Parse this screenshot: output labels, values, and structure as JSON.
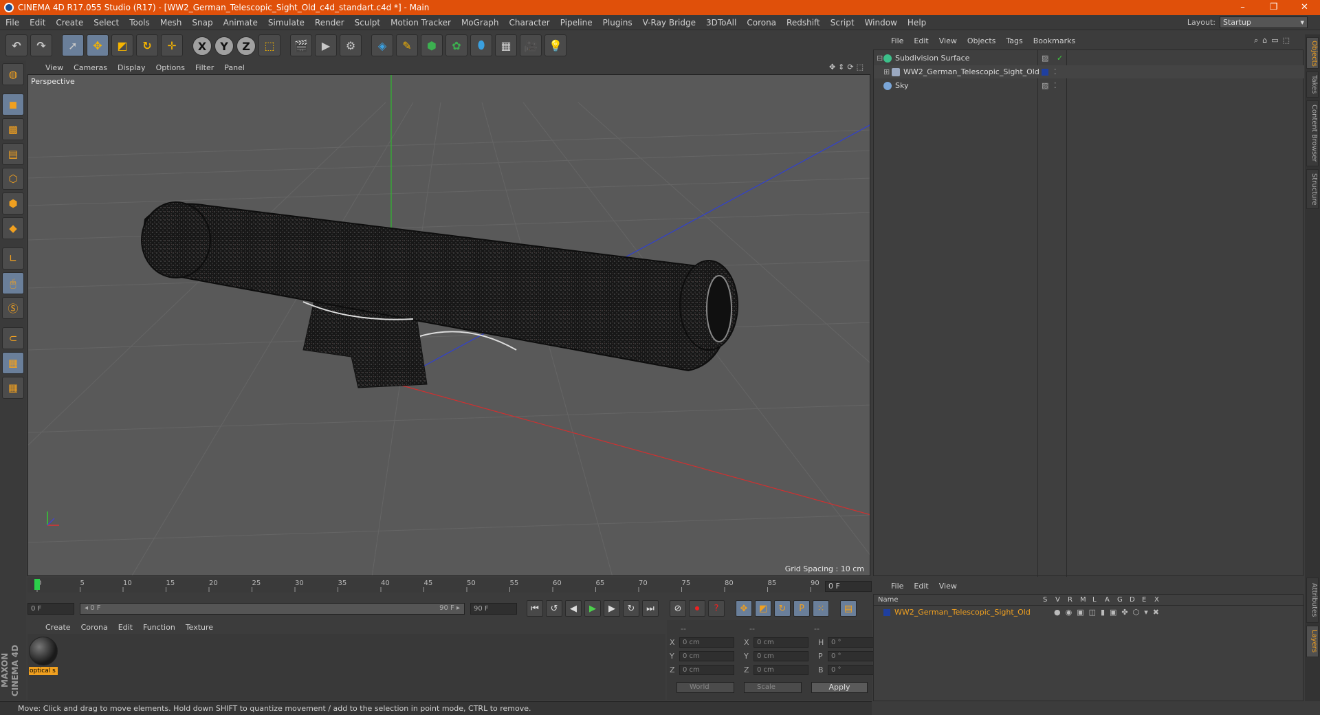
{
  "window": {
    "title": "CINEMA 4D R17.055 Studio (R17) - [WW2_German_Telescopic_Sight_Old_c4d_standart.c4d *] - Main",
    "controls": [
      "–",
      "❐",
      "✕"
    ]
  },
  "menu": [
    "File",
    "Edit",
    "Create",
    "Select",
    "Tools",
    "Mesh",
    "Snap",
    "Animate",
    "Simulate",
    "Render",
    "Sculpt",
    "Motion Tracker",
    "MoGraph",
    "Character",
    "Pipeline",
    "Plugins",
    "V-Ray Bridge",
    "3DToAll",
    "Corona",
    "Redshift",
    "Script",
    "Window",
    "Help"
  ],
  "layout": {
    "label": "Layout:",
    "value": "Startup"
  },
  "viewport": {
    "menu": [
      "View",
      "Cameras",
      "Display",
      "Options",
      "Filter",
      "Panel"
    ],
    "label": "Perspective",
    "grid_spacing": "Grid Spacing : 10 cm"
  },
  "timeline": {
    "ticks": [
      "0",
      "5",
      "10",
      "15",
      "20",
      "25",
      "30",
      "35",
      "40",
      "45",
      "50",
      "55",
      "60",
      "65",
      "70",
      "75",
      "80",
      "85",
      "90"
    ],
    "current_frame": "0 F",
    "start": "0 F",
    "range_start": "◂ 0 F",
    "range_end": "90 F ▸",
    "end": "90 F"
  },
  "materials": {
    "menu": [
      "Create",
      "Corona",
      "Edit",
      "Function",
      "Texture"
    ],
    "items": [
      {
        "name": "optical s"
      }
    ]
  },
  "coords": {
    "headers": [
      "--",
      "--",
      "--"
    ],
    "rows": [
      {
        "a": "X",
        "av": "0 cm",
        "b": "X",
        "bv": "0 cm",
        "c": "H",
        "cv": "0 °"
      },
      {
        "a": "Y",
        "av": "0 cm",
        "b": "Y",
        "bv": "0 cm",
        "c": "P",
        "cv": "0 °"
      },
      {
        "a": "Z",
        "av": "0 cm",
        "b": "Z",
        "bv": "0 cm",
        "c": "B",
        "cv": "0 °"
      }
    ],
    "mode1": "World",
    "mode2": "Scale",
    "apply": "Apply"
  },
  "status": "Move: Click and drag to move elements. Hold down SHIFT to quantize movement / add to the selection in point mode, CTRL to remove.",
  "maxon": {
    "line1": "MAXON",
    "line2": "CINEMA 4D"
  },
  "objects": {
    "menu": [
      "File",
      "Edit",
      "View",
      "Objects",
      "Tags",
      "Bookmarks"
    ],
    "items": [
      {
        "name": "Subdivision Surface",
        "color": "#3cc08a"
      },
      {
        "name": "WW2_German_Telescopic_Sight_Old",
        "color": "#9aa8c0"
      },
      {
        "name": "Sky",
        "color": "#7aa6d8"
      }
    ]
  },
  "layers": {
    "menu": [
      "File",
      "Edit",
      "View"
    ],
    "columns": [
      "Name",
      "S",
      "V",
      "R",
      "M",
      "L",
      "A",
      "G",
      "D",
      "E",
      "X"
    ],
    "items": [
      {
        "name": "WW2_German_Telescopic_Sight_Old",
        "color": "#1f3f9f"
      }
    ]
  },
  "right_tabs": [
    "Objects",
    "Takes",
    "Content Browser",
    "Structure",
    "Attributes",
    "Layers"
  ]
}
